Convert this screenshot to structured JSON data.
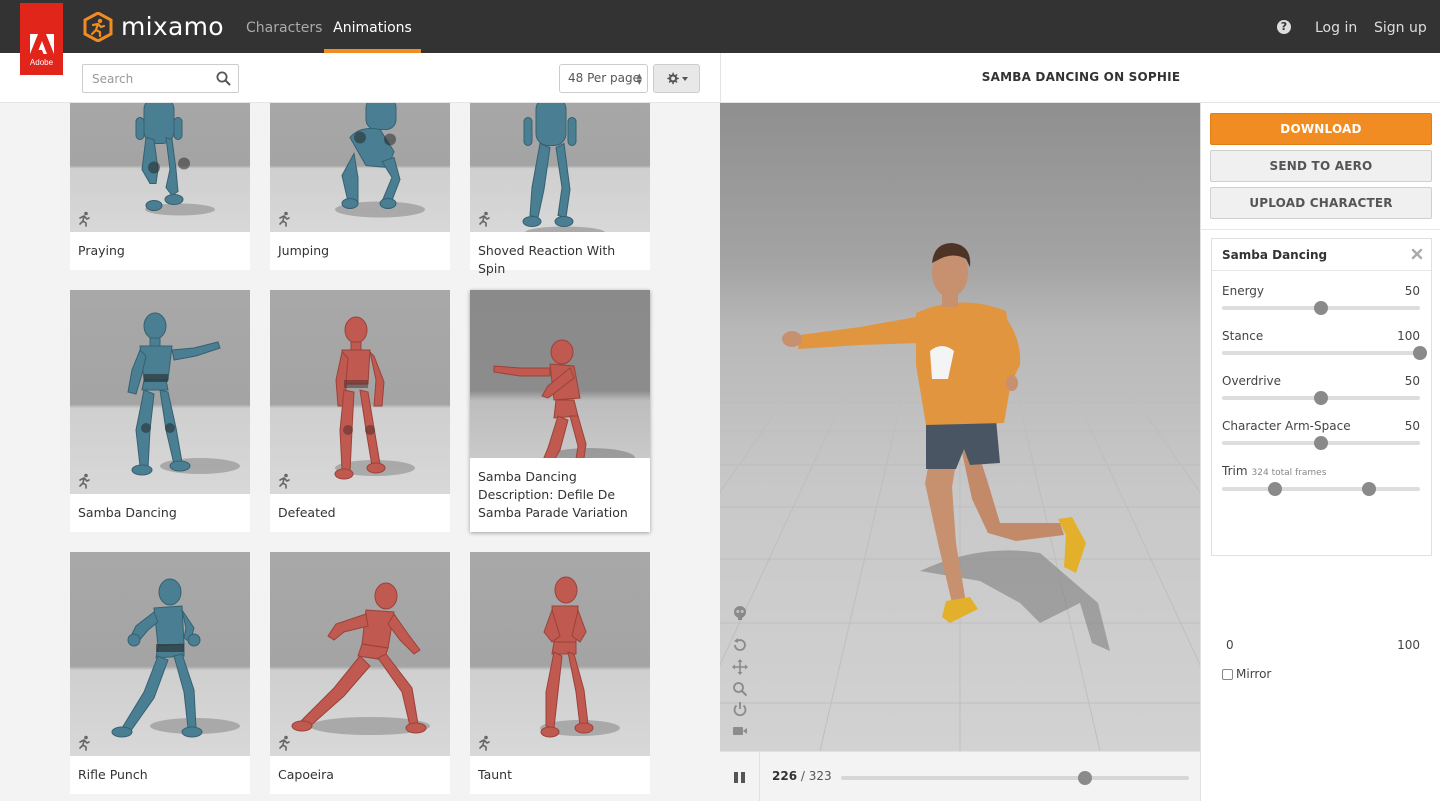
{
  "brand": {
    "name": "mixamo",
    "adobe_label": "Adobe",
    "accent": "#f08c22"
  },
  "nav": {
    "tabs": [
      {
        "label": "Characters",
        "active": false
      },
      {
        "label": "Animations",
        "active": true
      }
    ],
    "help_label": "?",
    "login_label": "Log in",
    "signup_label": "Sign up"
  },
  "browse": {
    "search": {
      "placeholder": "Search",
      "value": ""
    },
    "per_page": "48 Per page",
    "cards": [
      {
        "title": "Praying",
        "figure_color": "#4a7f93"
      },
      {
        "title": "Jumping",
        "figure_color": "#4a7f93"
      },
      {
        "title": "Shoved Reaction With Spin",
        "figure_color": "#4a7f93"
      },
      {
        "title": "Samba Dancing",
        "figure_color": "#4a7f93"
      },
      {
        "title": "Defeated",
        "figure_color": "#c0594f"
      },
      {
        "title": "Samba Dancing",
        "description": "Description: Defile De Samba Parade Variation",
        "figure_color": "#c0594f",
        "selected": true
      },
      {
        "title": "Rifle Punch",
        "figure_color": "#4a7f93"
      },
      {
        "title": "Capoeira",
        "figure_color": "#c0594f"
      },
      {
        "title": "Taunt",
        "figure_color": "#c0594f"
      }
    ]
  },
  "viewer": {
    "title": "SAMBA DANCING ON SOPHIE",
    "current_frame": "226",
    "frame_total": "/ 323",
    "progress": 0.7
  },
  "actions": {
    "download": "DOWNLOAD",
    "send_to_aero": "SEND TO AERO",
    "upload_character": "UPLOAD CHARACTER"
  },
  "settings": {
    "title": "Samba Dancing",
    "params": [
      {
        "name": "Energy",
        "value": "50",
        "level": 0.5
      },
      {
        "name": "Stance",
        "value": "100",
        "level": 1.0
      },
      {
        "name": "Overdrive",
        "value": "50",
        "level": 0.5
      },
      {
        "name": "Character Arm-Space",
        "value": "50",
        "level": 0.5
      }
    ],
    "trim": {
      "name": "Trim",
      "subtitle": "324 total frames",
      "min_label": "0",
      "max_label": "100",
      "start_level": 0.27,
      "end_level": 0.74
    },
    "mirror_label": "Mirror"
  }
}
